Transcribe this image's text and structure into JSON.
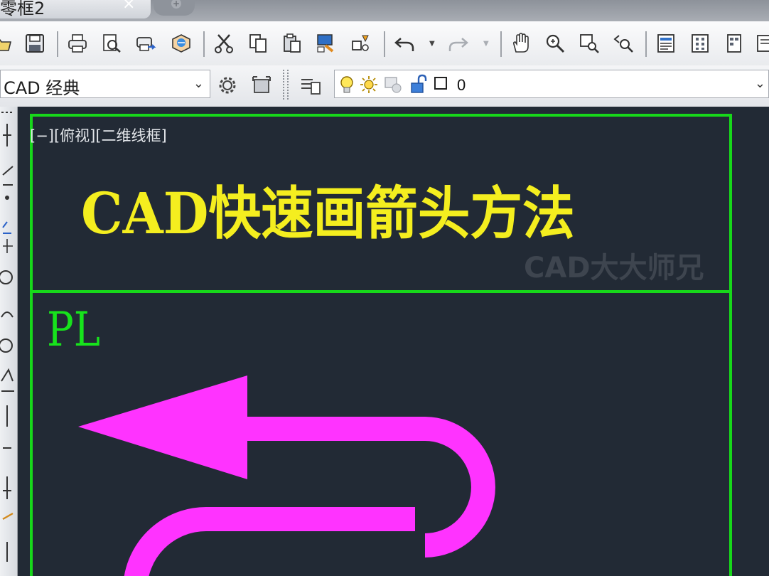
{
  "tab": {
    "title": "零框2",
    "close": "×",
    "add": "+"
  },
  "toolbar1": {
    "icons": [
      "open-icon",
      "save-icon",
      "print-icon",
      "print-preview-icon",
      "publish-icon",
      "3d-publish-icon",
      "cut-icon",
      "copy-icon",
      "paste-icon",
      "match-properties-icon",
      "block-editor-icon",
      "undo-icon",
      "redo-icon",
      "pan-icon",
      "zoom-realtime-icon",
      "zoom-window-icon",
      "zoom-previous-icon",
      "properties-icon",
      "design-center-icon",
      "tool-palettes-icon",
      "sheet-set-icon"
    ]
  },
  "toolbar2": {
    "workspace": "CAD 经典",
    "layer_name": "0"
  },
  "canvas": {
    "view_label": "[−][俯视][二维线框]",
    "title_text": "CAD快速画箭头方法",
    "watermark": "CAD大大师兄",
    "command_label": "PL"
  },
  "colors": {
    "background": "#222a35",
    "frame": "#17d81a",
    "title": "#f4ee1f",
    "arrow": "#ff33ff"
  }
}
